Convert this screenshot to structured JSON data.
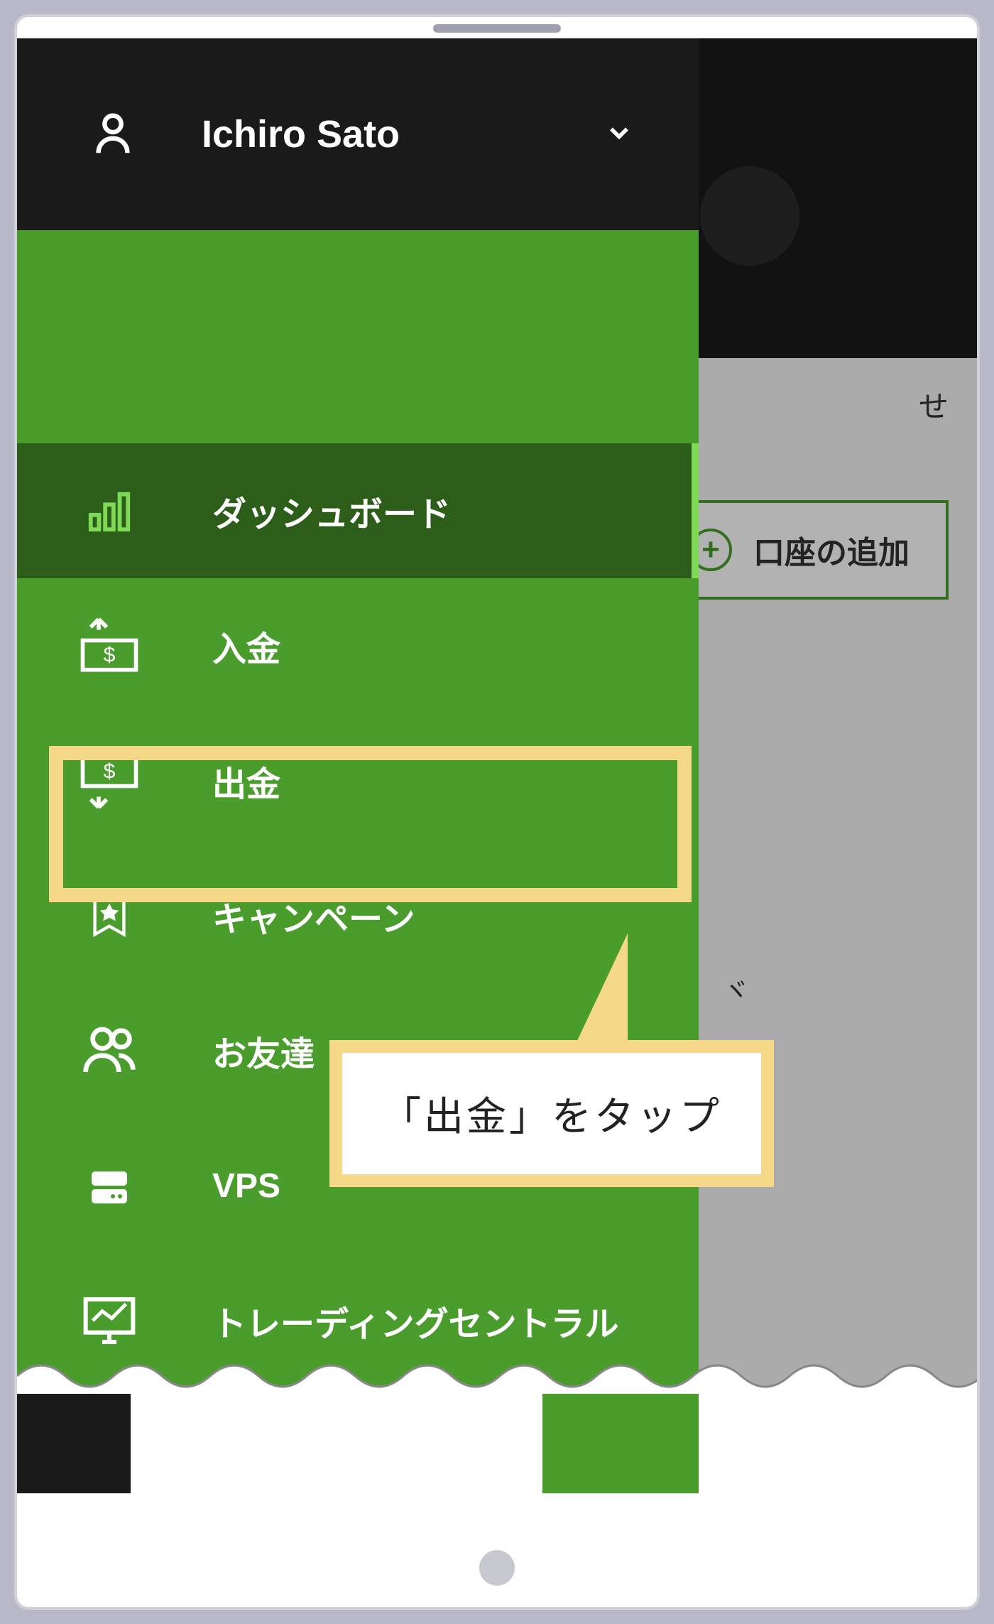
{
  "header": {
    "user_name": "Ichiro Sato"
  },
  "sidebar": {
    "items": [
      {
        "label": "ダッシュボード",
        "icon": "bar-chart-icon"
      },
      {
        "label": "入金",
        "icon": "deposit-icon"
      },
      {
        "label": "出金",
        "icon": "withdraw-icon"
      },
      {
        "label": "キャンペーン",
        "icon": "star-ribbon-icon"
      },
      {
        "label": "お友達",
        "icon": "friends-icon"
      },
      {
        "label": "VPS",
        "icon": "server-icon"
      },
      {
        "label": "トレーディングセントラル",
        "icon": "trading-monitor-icon"
      }
    ]
  },
  "background": {
    "tab_text": "せ",
    "add_account_label": "口座の追加",
    "partial_text": "ヾ"
  },
  "callout": {
    "text": "「出金」をタップ"
  },
  "colors": {
    "sidebar_bg": "#4a9d2d",
    "sidebar_active": "#2d5e19",
    "accent_green": "#7ed956",
    "header_bg": "#1a1a1a",
    "highlight": "#f5d988"
  }
}
